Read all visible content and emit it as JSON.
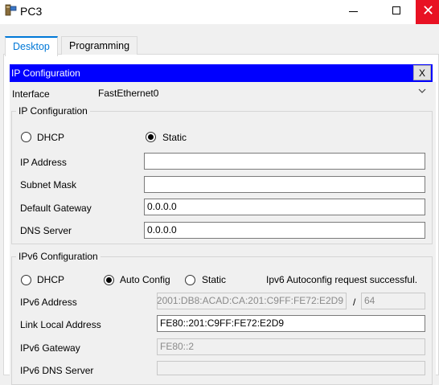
{
  "window": {
    "title": "PC3",
    "icon": "pc-icon"
  },
  "tabs": [
    {
      "label": "Desktop",
      "active": true
    },
    {
      "label": "Programming",
      "active": false
    }
  ],
  "dialog": {
    "title": "IP Configuration",
    "close_label": "X",
    "interface_label": "Interface",
    "interface_value": "FastEthernet0",
    "ipv4": {
      "legend": "IP Configuration",
      "dhcp_label": "DHCP",
      "static_label": "Static",
      "selected": "Static",
      "ip_address_label": "IP Address",
      "ip_address_value": "",
      "subnet_mask_label": "Subnet Mask",
      "subnet_mask_value": "",
      "gateway_label": "Default Gateway",
      "gateway_value": "0.0.0.0",
      "dns_label": "DNS Server",
      "dns_value": "0.0.0.0"
    },
    "ipv6": {
      "legend": "IPv6 Configuration",
      "dhcp_label": "DHCP",
      "auto_label": "Auto Config",
      "static_label": "Static",
      "selected": "Auto Config",
      "status_text": "Ipv6 Autoconfig request successful.",
      "address_label": "IPv6 Address",
      "address_value": "2001:DB8:ACAD:CA:201:C9FF:FE72:E2D9",
      "slash": "/",
      "prefix_value": "64",
      "link_local_label": "Link Local Address",
      "link_local_value": "FE80::201:C9FF:FE72:E2D9",
      "gateway_label": "IPv6 Gateway",
      "gateway_value": "FE80::2",
      "dns_label": "IPv6 DNS Server",
      "dns_value": ""
    }
  },
  "colors": {
    "dialog_header": "#0000ff",
    "accent": "#0078d7",
    "close_red": "#e81123"
  }
}
